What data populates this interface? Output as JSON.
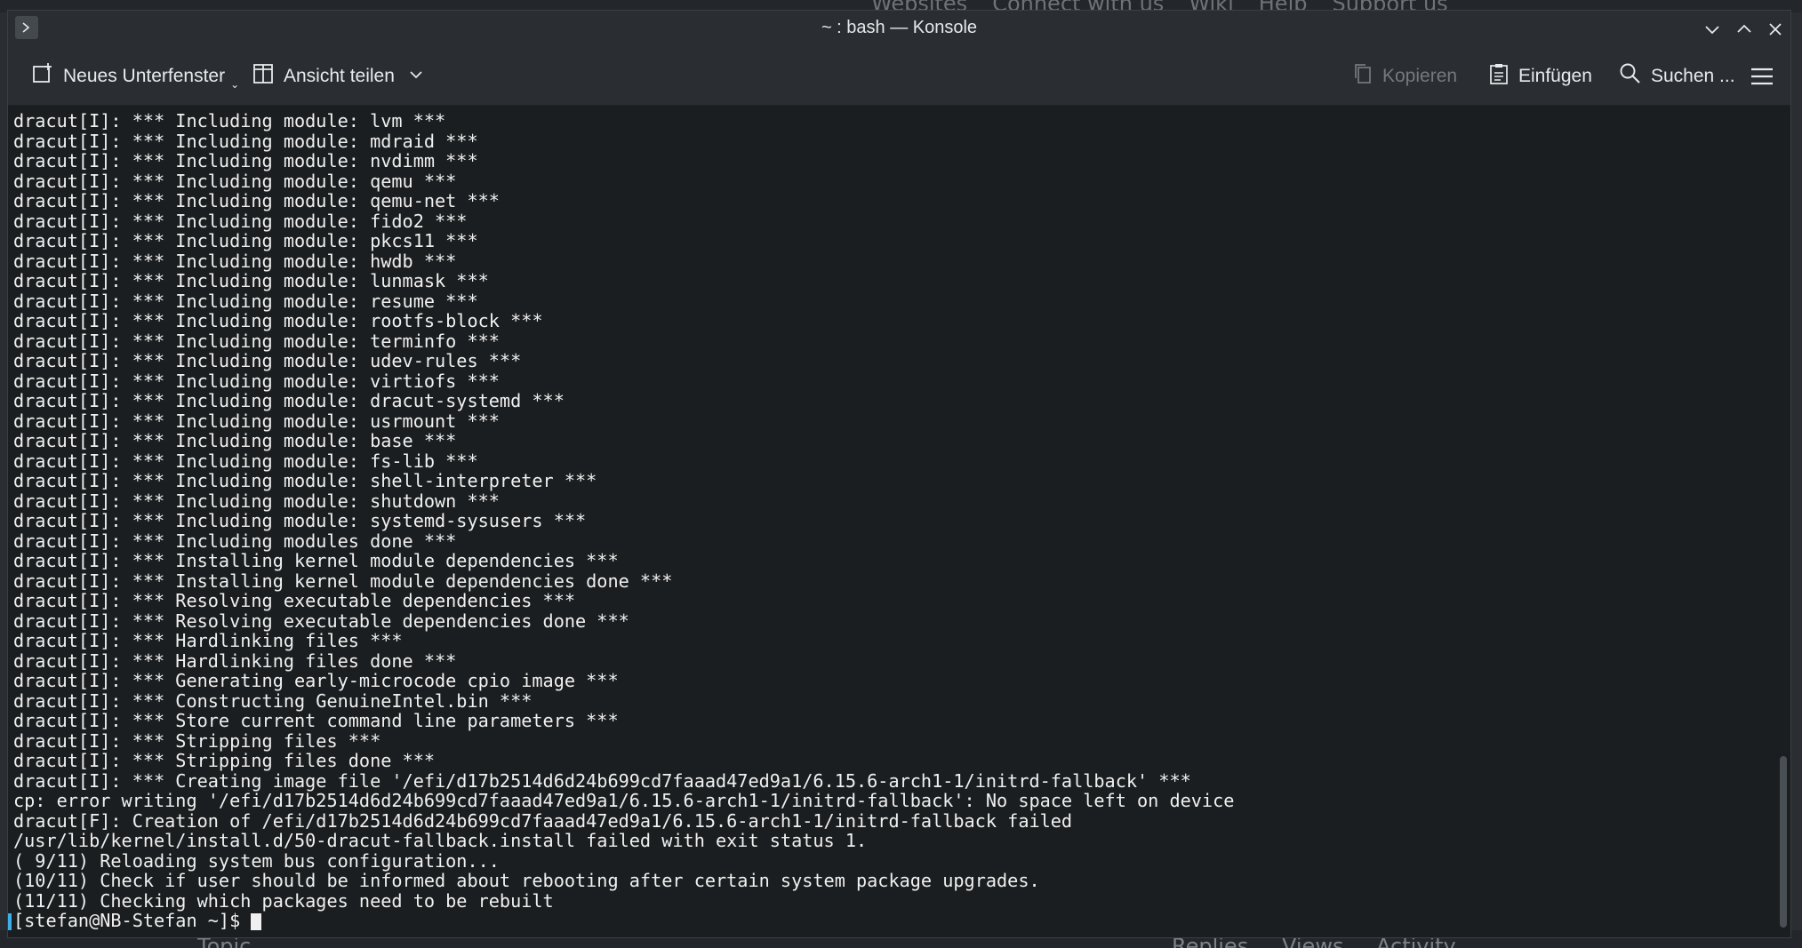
{
  "background_page": {
    "nav": [
      "Websites",
      "Connect with us",
      "Wiki",
      "Help",
      "Support us"
    ],
    "table_headers": [
      "Topic",
      "Replies",
      "Views",
      "Activity"
    ]
  },
  "window": {
    "title": "~ : bash — Konsole"
  },
  "toolbar": {
    "new_tab_label": "Neues Unterfenster",
    "split_view_label": "Ansicht teilen",
    "copy_label": "Kopieren",
    "paste_label": "Einfügen",
    "search_label": "Suchen ..."
  },
  "terminal": {
    "lines": [
      "dracut[I]: *** Including module: lvm ***",
      "dracut[I]: *** Including module: mdraid ***",
      "dracut[I]: *** Including module: nvdimm ***",
      "dracut[I]: *** Including module: qemu ***",
      "dracut[I]: *** Including module: qemu-net ***",
      "dracut[I]: *** Including module: fido2 ***",
      "dracut[I]: *** Including module: pkcs11 ***",
      "dracut[I]: *** Including module: hwdb ***",
      "dracut[I]: *** Including module: lunmask ***",
      "dracut[I]: *** Including module: resume ***",
      "dracut[I]: *** Including module: rootfs-block ***",
      "dracut[I]: *** Including module: terminfo ***",
      "dracut[I]: *** Including module: udev-rules ***",
      "dracut[I]: *** Including module: virtiofs ***",
      "dracut[I]: *** Including module: dracut-systemd ***",
      "dracut[I]: *** Including module: usrmount ***",
      "dracut[I]: *** Including module: base ***",
      "dracut[I]: *** Including module: fs-lib ***",
      "dracut[I]: *** Including module: shell-interpreter ***",
      "dracut[I]: *** Including module: shutdown ***",
      "dracut[I]: *** Including module: systemd-sysusers ***",
      "dracut[I]: *** Including modules done ***",
      "dracut[I]: *** Installing kernel module dependencies ***",
      "dracut[I]: *** Installing kernel module dependencies done ***",
      "dracut[I]: *** Resolving executable dependencies ***",
      "dracut[I]: *** Resolving executable dependencies done ***",
      "dracut[I]: *** Hardlinking files ***",
      "dracut[I]: *** Hardlinking files done ***",
      "dracut[I]: *** Generating early-microcode cpio image ***",
      "dracut[I]: *** Constructing GenuineIntel.bin ***",
      "dracut[I]: *** Store current command line parameters ***",
      "dracut[I]: *** Stripping files ***",
      "dracut[I]: *** Stripping files done ***",
      "dracut[I]: *** Creating image file '/efi/d17b2514d6d24b699cd7faaad47ed9a1/6.15.6-arch1-1/initrd-fallback' ***",
      "cp: error writing '/efi/d17b2514d6d24b699cd7faaad47ed9a1/6.15.6-arch1-1/initrd-fallback': No space left on device",
      "dracut[F]: Creation of /efi/d17b2514d6d24b699cd7faaad47ed9a1/6.15.6-arch1-1/initrd-fallback failed",
      "/usr/lib/kernel/install.d/50-dracut-fallback.install failed with exit status 1.",
      "( 9/11) Reloading system bus configuration...",
      "(10/11) Check if user should be informed about rebooting after certain system package upgrades.",
      "(11/11) Checking which packages need to be rebuilt"
    ],
    "prompt": "[stefan@NB-Stefan ~]$"
  },
  "colors": {
    "terminal_bg": "#1b1e20",
    "chrome_bg": "#2a2e32",
    "text": "#f0f0f0",
    "accent": "#3daee9"
  },
  "icons": [
    "terminal-icon",
    "new-tab-icon",
    "split-view-icon",
    "chevron-down-icon",
    "copy-icon",
    "paste-icon",
    "search-icon",
    "hamburger-menu-icon",
    "minimize-icon",
    "maximize-icon",
    "close-icon"
  ]
}
